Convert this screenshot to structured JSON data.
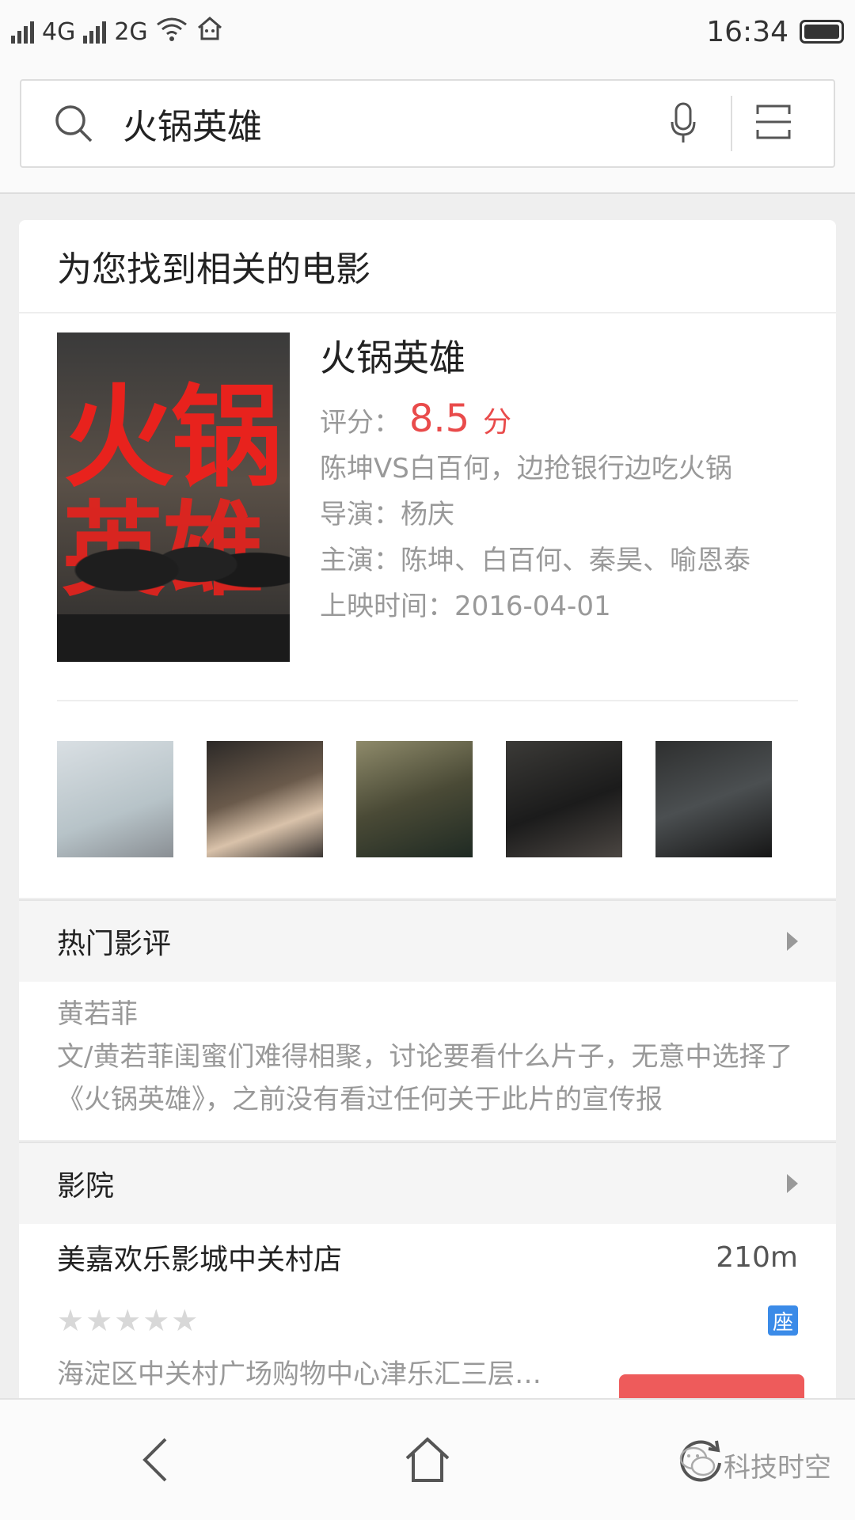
{
  "status_bar": {
    "network1": "4G",
    "network2": "2G",
    "time": "16:34"
  },
  "search": {
    "query": "火锅英雄"
  },
  "card": {
    "header": "为您找到相关的电影",
    "movie": {
      "title": "火锅英雄",
      "score_label": "评分：",
      "score_value": "8.5",
      "score_unit": "分",
      "tagline": "陈坤VS白百何，边抢银行边吃火锅",
      "director": "导演：杨庆",
      "cast": "主演：陈坤、白百何、秦昊、喻恩泰",
      "release": "上映时间：2016-04-01"
    }
  },
  "reviews": {
    "header": "热门影评",
    "author": "黄若菲",
    "text": "文/黄若菲闺蜜们难得相聚，讨论要看什么片子，无意中选择了《火锅英雄》，之前没有看过任何关于此片的宣传报"
  },
  "cinema": {
    "header": "影院",
    "name": "美嘉欢乐影城中关村店",
    "distance": "210m",
    "stars": "★★★★★",
    "seat_badge": "座",
    "address": "海淀区中关村广场购物中心津乐汇三层…"
  },
  "watermark": "科技时空",
  "colors": {
    "accent_red": "#e94b4b",
    "badge_blue": "#3b8be8"
  }
}
